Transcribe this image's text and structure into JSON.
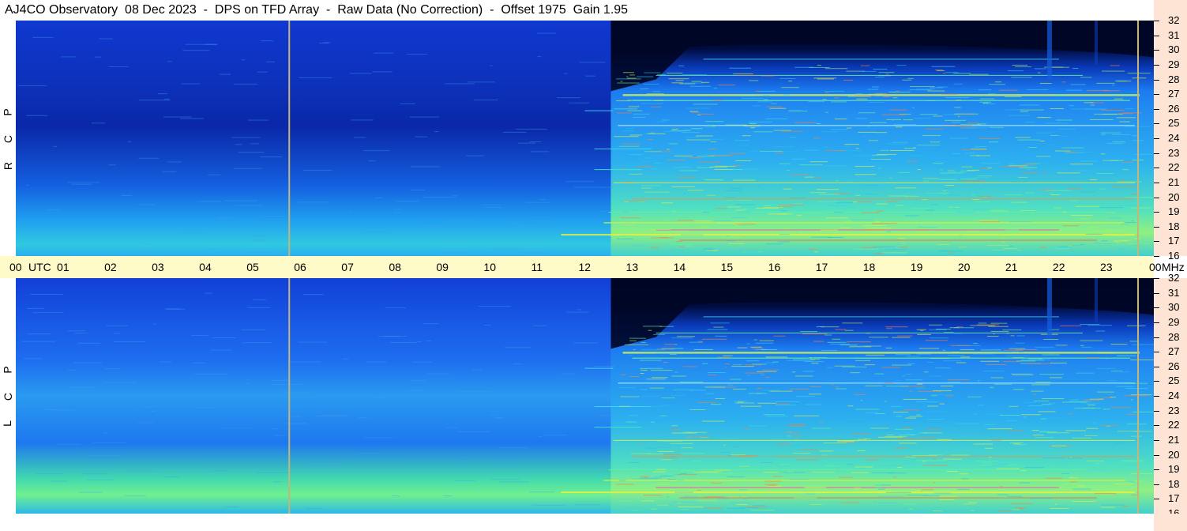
{
  "title": "AJ4CO Observatory  08 Dec 2023  -  DPS on TFD Array  -  Raw Data (No Correction)  -  Offset 1975  Gain 1.95",
  "chart_data": {
    "type": "heatmap",
    "panels": [
      {
        "name": "R C P",
        "letters": [
          "R",
          "C",
          "P"
        ]
      },
      {
        "name": "L C P",
        "letters": [
          "L",
          "C",
          "P"
        ]
      }
    ],
    "x_ticks": [
      "00",
      "01",
      "02",
      "03",
      "04",
      "05",
      "06",
      "07",
      "08",
      "09",
      "10",
      "11",
      "12",
      "13",
      "14",
      "15",
      "16",
      "17",
      "18",
      "19",
      "20",
      "21",
      "22",
      "23",
      "00"
    ],
    "x_unit": "UTC",
    "y_ticks": [
      "32",
      "31",
      "30",
      "29",
      "28",
      "27",
      "26",
      "25",
      "24",
      "23",
      "22",
      "21",
      "20",
      "19",
      "18",
      "17",
      "16"
    ],
    "y_unit": "MHz",
    "xlim": [
      0,
      24
    ],
    "ylim": [
      16,
      32
    ],
    "marker_lines_utc": [
      5.75,
      23.65
    ],
    "colormap": [
      "#00002a",
      "#0a2cc8",
      "#1e7cf0",
      "#2cc0e8",
      "#6ef0a0",
      "#e8f040",
      "#ff6040",
      "#ff40c0"
    ],
    "colors": {
      "axis_bg": "#fffbc8",
      "freq_bg": "#fde4d4",
      "marker": "#c8b478"
    }
  }
}
